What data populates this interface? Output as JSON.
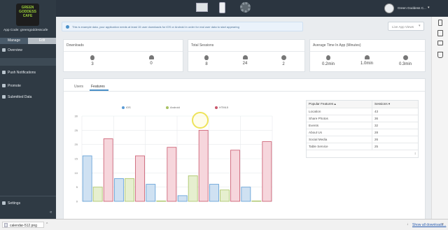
{
  "sidebar": {
    "logo_lines": [
      "GREEN",
      "GODDESS",
      "CAFE"
    ],
    "app_code": "App Code: greengoddesscafe",
    "tabs": [
      {
        "label": "Manage"
      },
      {
        "label": "Edit"
      }
    ],
    "items": [
      {
        "label": "Overview",
        "icon": "eye-icon",
        "active": true
      },
      {
        "label": "Push Notifications",
        "icon": "bell-icon"
      },
      {
        "label": "Promote",
        "icon": "share-icon"
      },
      {
        "label": "Submitted Data",
        "icon": "document-icon"
      }
    ],
    "settings_label": "Settings"
  },
  "topbar": {
    "icons": [
      "desktop-preview-icon",
      "phone-preview-icon",
      "gear-icon"
    ],
    "user_name": "Green Goddess C..."
  },
  "notice": {
    "text": "This is example data, your application needs at least 15 user downloads for iOS or Android in order for real user data to start appearing"
  },
  "dropdown": {
    "label": "Live App Views"
  },
  "cards": [
    {
      "title": "Downloads",
      "stats": [
        {
          "icon": "apple-icon",
          "value": "3"
        },
        {
          "icon": "android-icon",
          "value": "0"
        }
      ]
    },
    {
      "title": "Total Sessions",
      "stats": [
        {
          "icon": "apple-icon",
          "value": "8"
        },
        {
          "icon": "android-icon",
          "value": "24"
        },
        {
          "icon": "html5-icon",
          "value": "2"
        }
      ]
    },
    {
      "title": "Average Time In App (Minutes)",
      "stats": [
        {
          "icon": "apple-icon",
          "value": "0.2min"
        },
        {
          "icon": "android-icon",
          "value": "1.0min"
        },
        {
          "icon": "html5-icon",
          "value": "0.3min"
        }
      ]
    }
  ],
  "tabs": [
    {
      "label": "Users"
    },
    {
      "label": "Features",
      "active": true
    }
  ],
  "chart_data": {
    "type": "bar",
    "categories": [
      "1",
      "2",
      "3",
      "4",
      "5",
      "6"
    ],
    "series": [
      {
        "name": "iOS",
        "color": "#5b9bd5",
        "fill": "#cfe1f2",
        "values": [
          16,
          8,
          6,
          2,
          6,
          5
        ]
      },
      {
        "name": "Android",
        "color": "#a8c263",
        "fill": "#e6efcf",
        "values": [
          5,
          8,
          0,
          9,
          4,
          0
        ]
      },
      {
        "name": "HTML5",
        "color": "#c9566b",
        "fill": "#f6d6dc",
        "values": [
          22,
          16,
          19,
          25,
          18,
          21
        ]
      }
    ],
    "ylim": [
      0,
      30
    ],
    "yticks": [
      "0",
      "5",
      "10",
      "15",
      "20",
      "25",
      "30"
    ],
    "grid": true,
    "legend": "top"
  },
  "table": {
    "headers": [
      "Popular Features",
      "Sessions"
    ],
    "rows": [
      [
        "Location",
        "43"
      ],
      [
        "Share Photos",
        "36"
      ],
      [
        "Events",
        "32"
      ],
      [
        "About Us",
        "28"
      ],
      [
        "Social Media",
        "26"
      ],
      [
        "Table Service",
        "25"
      ]
    ]
  },
  "right_tools": [
    "phone-icon",
    "tablet-icon",
    "print-icon",
    "html5-icon"
  ],
  "download_bar": {
    "file": "calendar-512.png",
    "show_all": "Show all downloads..."
  },
  "colors": {
    "sidebar": "#2f3a44",
    "accent": "#4a90c8"
  }
}
